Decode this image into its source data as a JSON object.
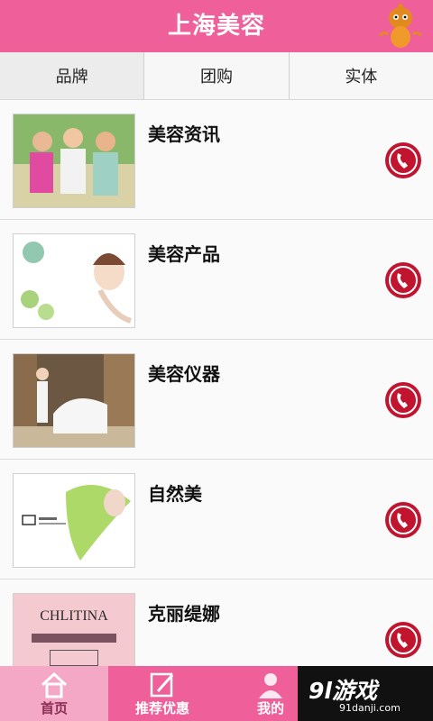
{
  "header": {
    "title": "上海美容"
  },
  "tabs": [
    {
      "label": "品牌"
    },
    {
      "label": "团购"
    },
    {
      "label": "实体"
    }
  ],
  "list": [
    {
      "title": "美容资讯"
    },
    {
      "title": "美容产品"
    },
    {
      "title": "美容仪器"
    },
    {
      "title": "自然美"
    },
    {
      "title": "克丽缇娜",
      "thumb_text": "CHLITINA"
    }
  ],
  "tabbar": [
    {
      "label": "首页"
    },
    {
      "label": "推荐优惠"
    },
    {
      "label": "我的"
    }
  ],
  "watermark": {
    "main": "9l游戏",
    "sub": "91danji.com"
  },
  "colors": {
    "brand_pink": "#ef5f99",
    "call_red": "#c0142f"
  },
  "icons": {
    "call": "phone-call-icon",
    "home": "home-icon",
    "promo": "edit-icon",
    "user": "user-icon"
  }
}
